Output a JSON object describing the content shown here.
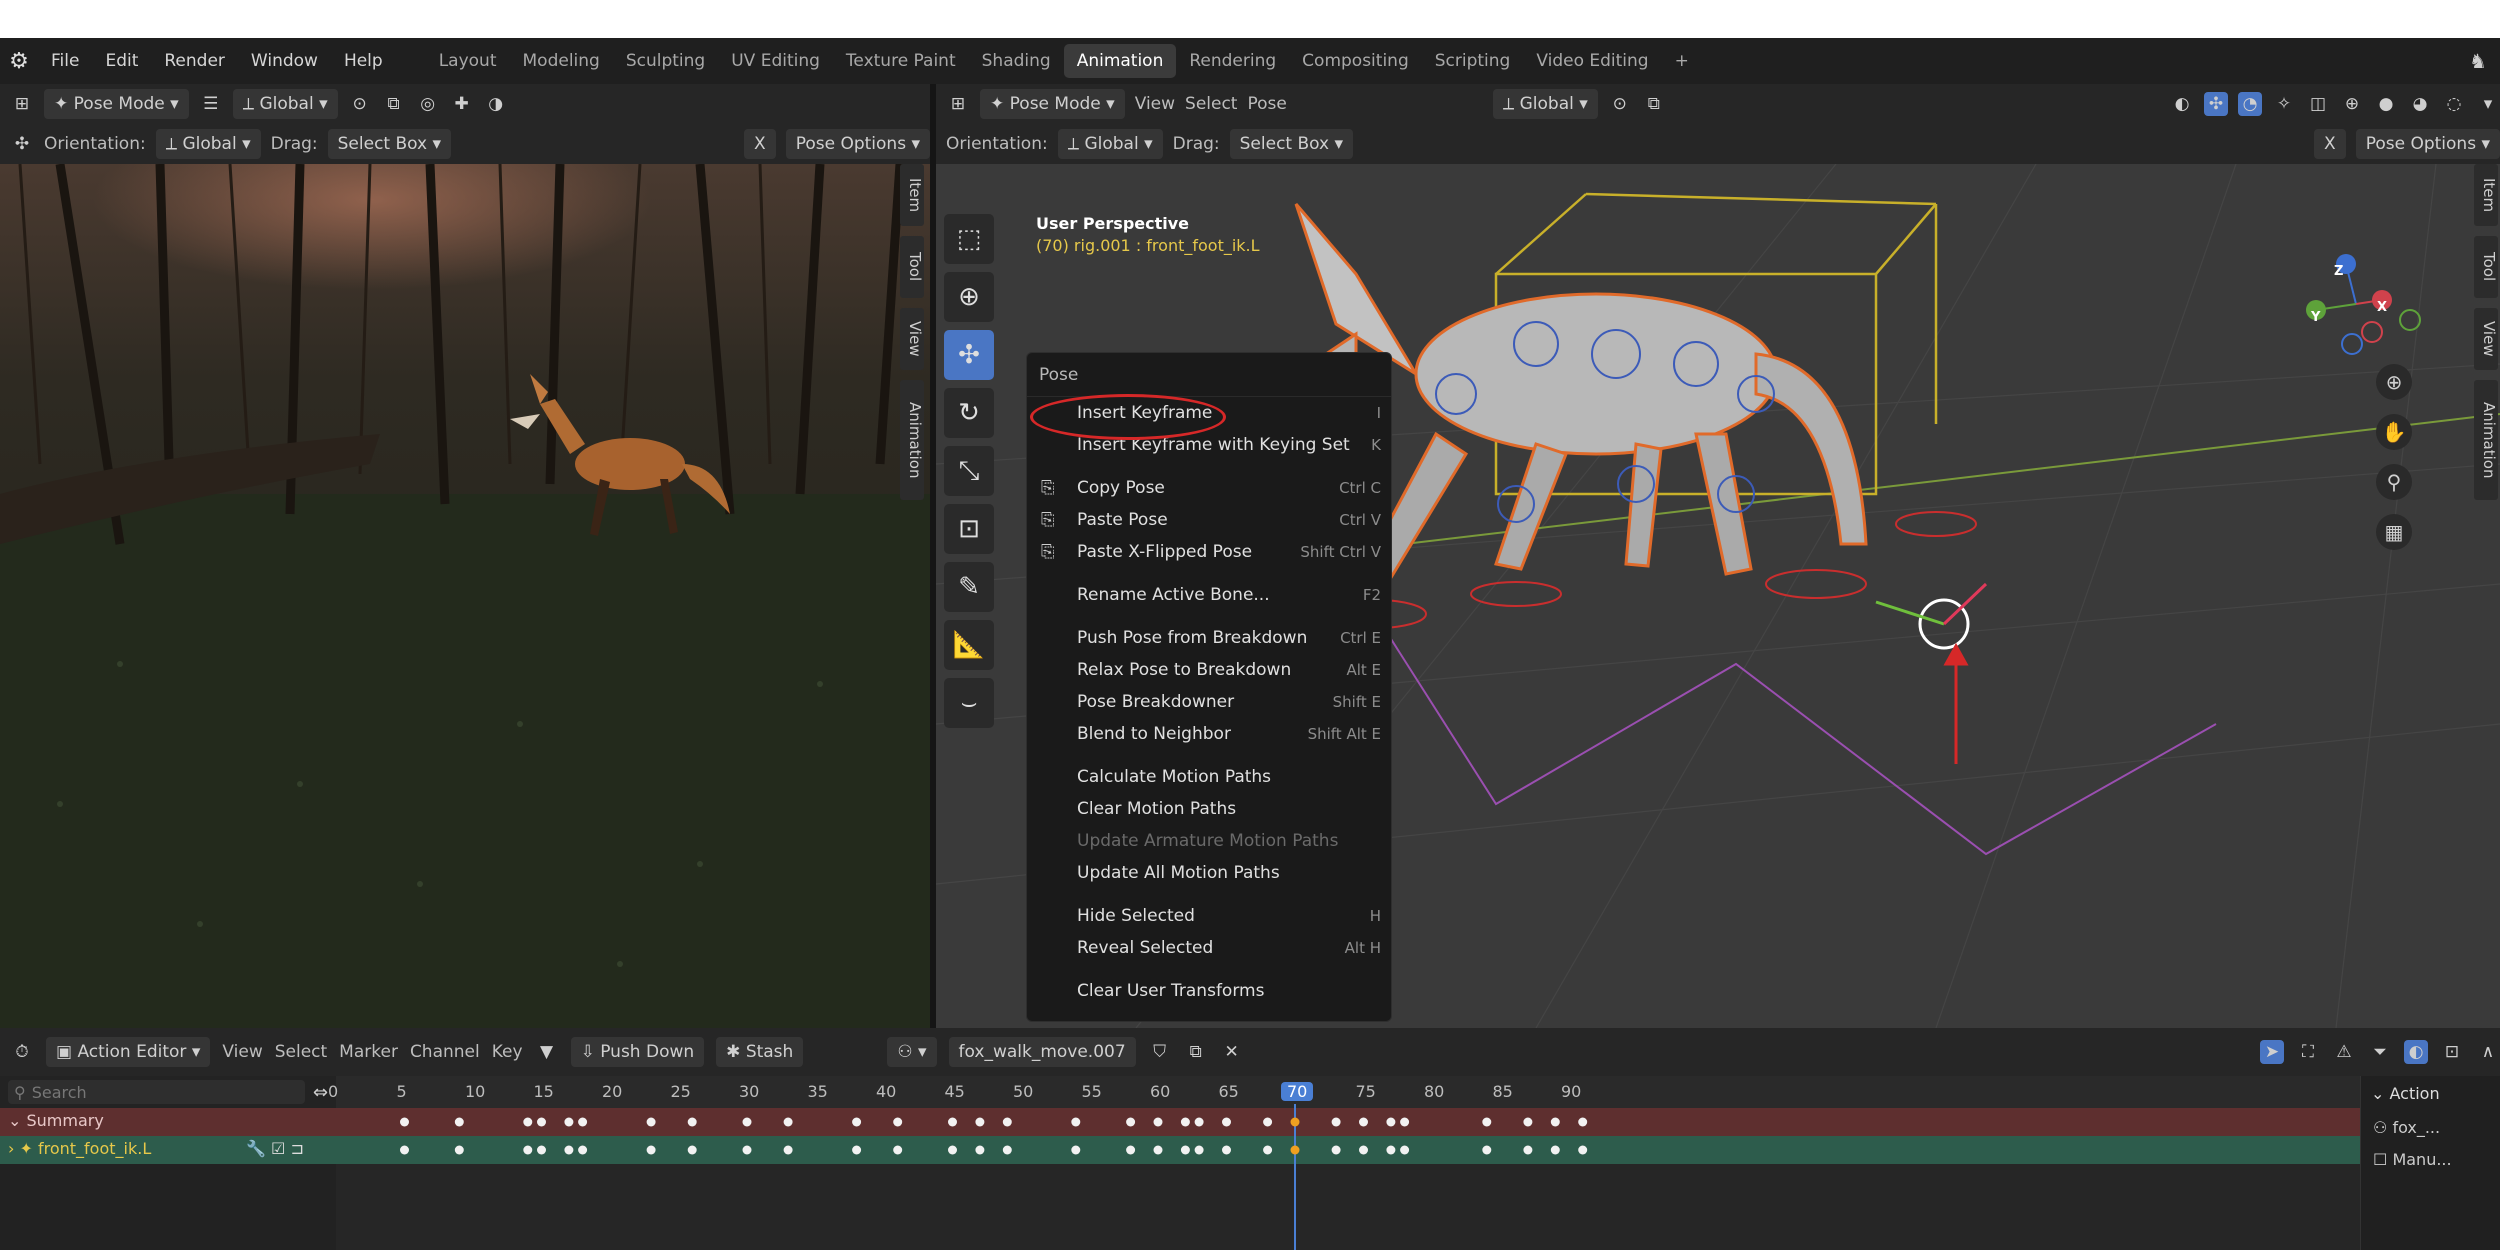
{
  "topbar": {
    "menus": [
      "File",
      "Edit",
      "Render",
      "Window",
      "Help"
    ],
    "workspaces": [
      "Layout",
      "Modeling",
      "Sculpting",
      "UV Editing",
      "Texture Paint",
      "Shading",
      "Animation",
      "Rendering",
      "Compositing",
      "Scripting",
      "Video Editing"
    ],
    "active_workspace": "Animation",
    "add_tab": "+"
  },
  "left_viewport": {
    "mode": "Pose Mode",
    "transform_global": "Global",
    "orientation_label": "Orientation:",
    "orientation_value": "Global",
    "drag_label": "Drag:",
    "drag_value": "Select Box",
    "pose_options": "Pose Options",
    "x_label": "X",
    "tabs": [
      "Item",
      "Tool",
      "View",
      "Animation"
    ]
  },
  "right_viewport": {
    "mode": "Pose Mode",
    "menus": [
      "View",
      "Select",
      "Pose"
    ],
    "transform_global": "Global",
    "orientation_label": "Orientation:",
    "orientation_value": "Global",
    "drag_label": "Drag:",
    "drag_value": "Select Box",
    "pose_options": "Pose Options",
    "x_label": "X",
    "overlay_title": "User Perspective",
    "overlay_subtitle": "(70) rig.001 : front_foot_ik.L",
    "tabs": [
      "Item",
      "Tool",
      "View",
      "Animation"
    ],
    "gizmo_axes": {
      "z": "Z",
      "x": "X",
      "y": "Y"
    }
  },
  "context_menu": {
    "title": "Pose",
    "items": [
      {
        "label": "Insert Keyframe",
        "shortcut": "I",
        "icon": ""
      },
      {
        "label": "Insert Keyframe with Keying Set",
        "shortcut": "K",
        "icon": ""
      },
      {
        "sep": true
      },
      {
        "label": "Copy Pose",
        "shortcut": "Ctrl C",
        "icon": "copy-icon"
      },
      {
        "label": "Paste Pose",
        "shortcut": "Ctrl V",
        "icon": "paste-icon"
      },
      {
        "label": "Paste X-Flipped Pose",
        "shortcut": "Shift Ctrl V",
        "icon": "paste-flipped-icon"
      },
      {
        "sep": true
      },
      {
        "label": "Rename Active Bone...",
        "shortcut": "F2",
        "icon": ""
      },
      {
        "sep": true
      },
      {
        "label": "Push Pose from Breakdown",
        "shortcut": "Ctrl E",
        "icon": ""
      },
      {
        "label": "Relax Pose to Breakdown",
        "shortcut": "Alt E",
        "icon": ""
      },
      {
        "label": "Pose Breakdowner",
        "shortcut": "Shift E",
        "icon": ""
      },
      {
        "label": "Blend to Neighbor",
        "shortcut": "Shift Alt E",
        "icon": ""
      },
      {
        "sep": true
      },
      {
        "label": "Calculate Motion Paths",
        "shortcut": "",
        "icon": ""
      },
      {
        "label": "Clear Motion Paths",
        "shortcut": "",
        "icon": ""
      },
      {
        "label": "Update Armature Motion Paths",
        "shortcut": "",
        "icon": "",
        "disabled": true
      },
      {
        "label": "Update All Motion Paths",
        "shortcut": "",
        "icon": ""
      },
      {
        "sep": true
      },
      {
        "label": "Hide Selected",
        "shortcut": "H",
        "icon": ""
      },
      {
        "label": "Reveal Selected",
        "shortcut": "Alt H",
        "icon": ""
      },
      {
        "sep": true
      },
      {
        "label": "Clear User Transforms",
        "shortcut": "",
        "icon": ""
      }
    ]
  },
  "timeline": {
    "editor": "Action Editor",
    "menus": [
      "View",
      "Select",
      "Marker",
      "Channel",
      "Key"
    ],
    "push_down": "Push Down",
    "stash": "Stash",
    "action_name": "fox_walk_move.007",
    "search_placeholder": "Search",
    "ruler_ticks": [
      0,
      5,
      10,
      15,
      20,
      25,
      30,
      35,
      40,
      45,
      50,
      55,
      60,
      65,
      70,
      75,
      80,
      85,
      90
    ],
    "current_frame": 70,
    "channels": [
      {
        "name": "Summary",
        "color": "#5e2f2f"
      },
      {
        "name": "front_foot_ik.L",
        "color": "#2d5c4c"
      }
    ],
    "keyframes": [
      5,
      9,
      14,
      15,
      17,
      18,
      23,
      26,
      30,
      33,
      38,
      41,
      45,
      47,
      49,
      54,
      58,
      60,
      62,
      63,
      65,
      68,
      70,
      73,
      75,
      77,
      78,
      84,
      87,
      89,
      91
    ]
  },
  "side_panel": {
    "title": "Action",
    "slot_label": "fox_...",
    "manual_label": "Manu..."
  },
  "colors": {
    "accent": "#4a76c4",
    "highlight_red": "#d62828",
    "playhead": "#4a7fd4"
  }
}
